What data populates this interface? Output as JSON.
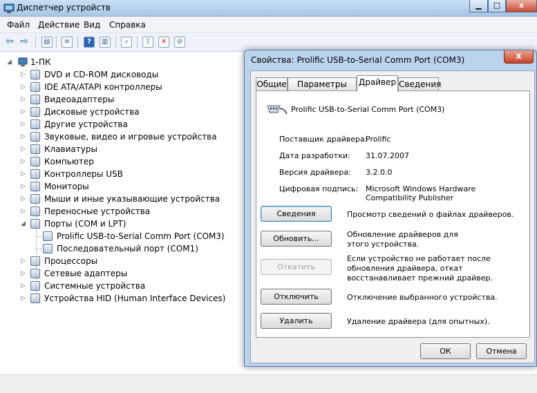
{
  "window": {
    "title": "Диспетчер устройств",
    "menu": [
      "Файл",
      "Действие",
      "Вид",
      "Справка"
    ]
  },
  "tree": {
    "root": "1-ПК",
    "items": [
      {
        "label": "DVD и CD-ROM дисководы",
        "icon": "cdrom-icon"
      },
      {
        "label": "IDE ATA/ATAPI контроллеры",
        "icon": "ide-controller-icon"
      },
      {
        "label": "Видеоадаптеры",
        "icon": "display-adapter-icon"
      },
      {
        "label": "Дисковые устройства",
        "icon": "disk-drive-icon"
      },
      {
        "label": "Другие устройства",
        "icon": "unknown-device-icon"
      },
      {
        "label": "Звуковые, видео и игровые устройства",
        "icon": "speaker-icon"
      },
      {
        "label": "Клавиатуры",
        "icon": "keyboard-icon"
      },
      {
        "label": "Компьютер",
        "icon": "computer-icon"
      },
      {
        "label": "Контроллеры USB",
        "icon": "usb-icon"
      },
      {
        "label": "Мониторы",
        "icon": "monitor-icon"
      },
      {
        "label": "Мыши и иные указывающие устройства",
        "icon": "mouse-icon"
      },
      {
        "label": "Переносные устройства",
        "icon": "portable-device-icon"
      },
      {
        "label": "Порты (COM и LPT)",
        "icon": "port-icon",
        "expanded": true
      },
      {
        "label": "Prolific USB-to-Serial Comm Port (COM3)",
        "icon": "port-icon",
        "child": true
      },
      {
        "label": "Последовательный порт (COM1)",
        "icon": "port-icon",
        "child": true
      },
      {
        "label": "Процессоры",
        "icon": "processor-icon"
      },
      {
        "label": "Сетевые адаптеры",
        "icon": "network-adapter-icon"
      },
      {
        "label": "Системные устройства",
        "icon": "system-device-icon"
      },
      {
        "label": "Устройства HID (Human Interface Devices)",
        "icon": "hid-icon"
      }
    ]
  },
  "dialog": {
    "title": "Свойства: Prolific USB-to-Serial Comm Port (COM3)",
    "close": "x",
    "tabs": [
      "Общие",
      "Параметры порта",
      "Драйвер",
      "Сведения"
    ],
    "active_tab": "Драйвер",
    "device_name": "Prolific USB-to-Serial Comm Port (COM3)",
    "fields": [
      {
        "label": "Поставщик драйвера:",
        "value": "Prolific"
      },
      {
        "label": "Дата разработки:",
        "value": "31.07.2007"
      },
      {
        "label": "Версия драйвера:",
        "value": "3.2.0.0"
      },
      {
        "label": "Цифровая подпись:",
        "value": "Microsoft Windows Hardware Compatibility Publisher"
      }
    ],
    "actions": [
      {
        "button": "Сведения",
        "desc": "Просмотр сведений о файлах драйверов."
      },
      {
        "button": "Обновить...",
        "desc": "Обновление драйверов для этого устройства."
      },
      {
        "button": "Откатить",
        "desc": "Если устройство не работает после обновления драйвера, откат восстанавливает прежний драйвер.",
        "disabled": true
      },
      {
        "button": "Отключить",
        "desc": "Отключение выбранного устройства."
      },
      {
        "button": "Удалить",
        "desc": "Удаление драйвера (для опытных)."
      }
    ],
    "ok": "ОК",
    "cancel": "Отмена"
  }
}
